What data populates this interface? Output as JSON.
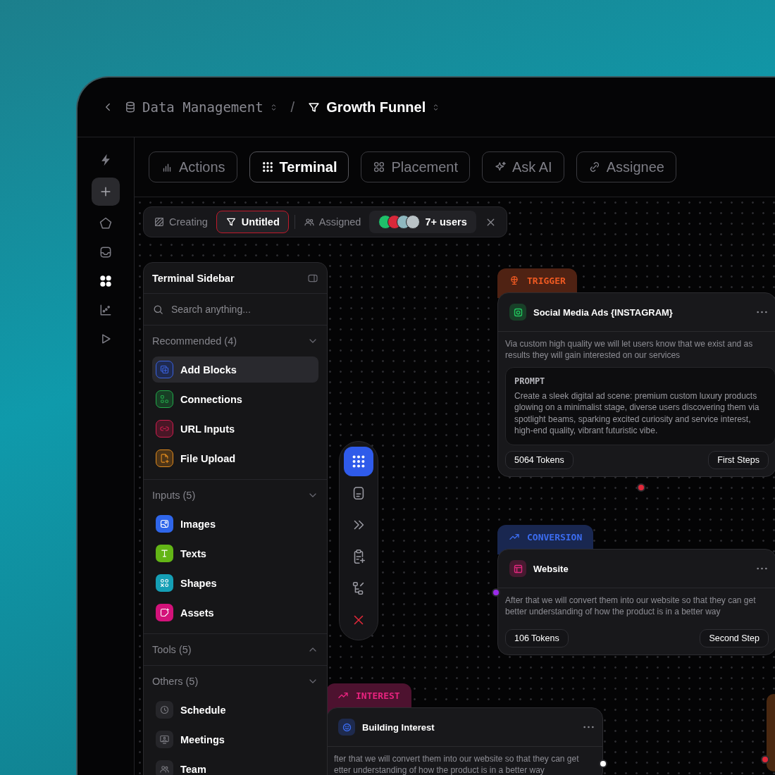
{
  "header": {
    "workspace": "Data Management",
    "separator": "/",
    "project": "Growth Funnel"
  },
  "rail": {
    "items": [
      {
        "selected": false
      },
      {
        "selected": false
      },
      {
        "selected": false
      },
      {
        "selected": false
      },
      {
        "selected": true
      },
      {
        "selected": false
      },
      {
        "selected": false
      }
    ]
  },
  "tabs": [
    {
      "label": "Actions",
      "selected": false
    },
    {
      "label": "Terminal",
      "selected": true
    },
    {
      "label": "Placement",
      "selected": false
    },
    {
      "label": "Ask AI",
      "selected": false
    },
    {
      "label": "Assignee",
      "selected": false
    }
  ],
  "filter_bar": {
    "creating": "Creating",
    "title": {
      "label": "Untitled",
      "selected": true
    },
    "assigned": "Assigned",
    "users": {
      "label": "7+ users",
      "avatars": [
        {
          "color": "#1fbf6a"
        },
        {
          "color": "#d8283a"
        },
        {
          "color": "#8fb8c0"
        },
        {
          "color": "#b9c2c6"
        }
      ]
    }
  },
  "sidebar": {
    "title": "Terminal Sidebar",
    "search": {
      "placeholder": "Search anything..."
    },
    "sections": [
      {
        "title": "Recommended (4)",
        "expanded": true,
        "kind": "tinted",
        "items": [
          {
            "label": "Add Blocks",
            "color": "#3b63e0",
            "selected": true
          },
          {
            "label": "Connections",
            "color": "#22a94a",
            "selected": false
          },
          {
            "label": "URL Inputs",
            "color": "#d11d4f",
            "selected": false
          },
          {
            "label": "File Upload",
            "color": "#e08a1e",
            "selected": false
          }
        ]
      },
      {
        "title": "Inputs (5)",
        "expanded": true,
        "kind": "solid",
        "items": [
          {
            "label": "Images",
            "color": "#2f66ea",
            "selected": false
          },
          {
            "label": "Texts",
            "color": "#63b516",
            "selected": false
          },
          {
            "label": "Shapes",
            "color": "#159fb5",
            "selected": false
          },
          {
            "label": "Assets",
            "color": "#d3127a",
            "selected": false
          }
        ]
      },
      {
        "title": "Tools (5)",
        "expanded": false
      },
      {
        "title": "Others (5)",
        "expanded": true,
        "kind": "plain",
        "items": [
          {
            "label": "Schedule",
            "selected": false
          },
          {
            "label": "Meetings",
            "selected": false
          },
          {
            "label": "Team",
            "selected": false
          }
        ]
      }
    ]
  },
  "toolbar": {
    "items": [
      {
        "selected": true
      },
      {
        "selected": false
      },
      {
        "selected": false
      },
      {
        "selected": false
      },
      {
        "selected": false
      },
      {
        "selected": false
      }
    ]
  },
  "nodes": [
    {
      "category": "TRIGGER",
      "color": "#f05a22",
      "title": "Social Media Ads {INSTAGRAM}",
      "icon": {
        "color": "#22c55e"
      },
      "description": "Via custom high quality we will let users know that we exist and as results they will gain interested on our services",
      "prompt": {
        "label": "PROMPT",
        "text": "Create a sleek digital ad scene: premium custom luxury products glowing on a minimalist stage, diverse users discovering them via spotlight beams, sparking excited curiosity and service interest, high-end quality, vibrant futuristic vibe."
      },
      "tokens": "5064 Tokens",
      "step": "First Steps"
    },
    {
      "category": "CONVERSION",
      "color": "#3b6cf0",
      "title": "Website",
      "icon": {
        "color": "#e0287d"
      },
      "description": "After that we will convert them into our website so that they can get better understanding of how the product is in a better way",
      "tokens": "106 Tokens",
      "step": "Second Step"
    },
    {
      "category": "INTEREST",
      "color": "#e8237f",
      "title": "Building Interest",
      "icon": {
        "color": "#3b6cf0"
      },
      "description": "fter that we will convert them into our website so that they can get etter understanding of how the product is in a better way"
    }
  ]
}
